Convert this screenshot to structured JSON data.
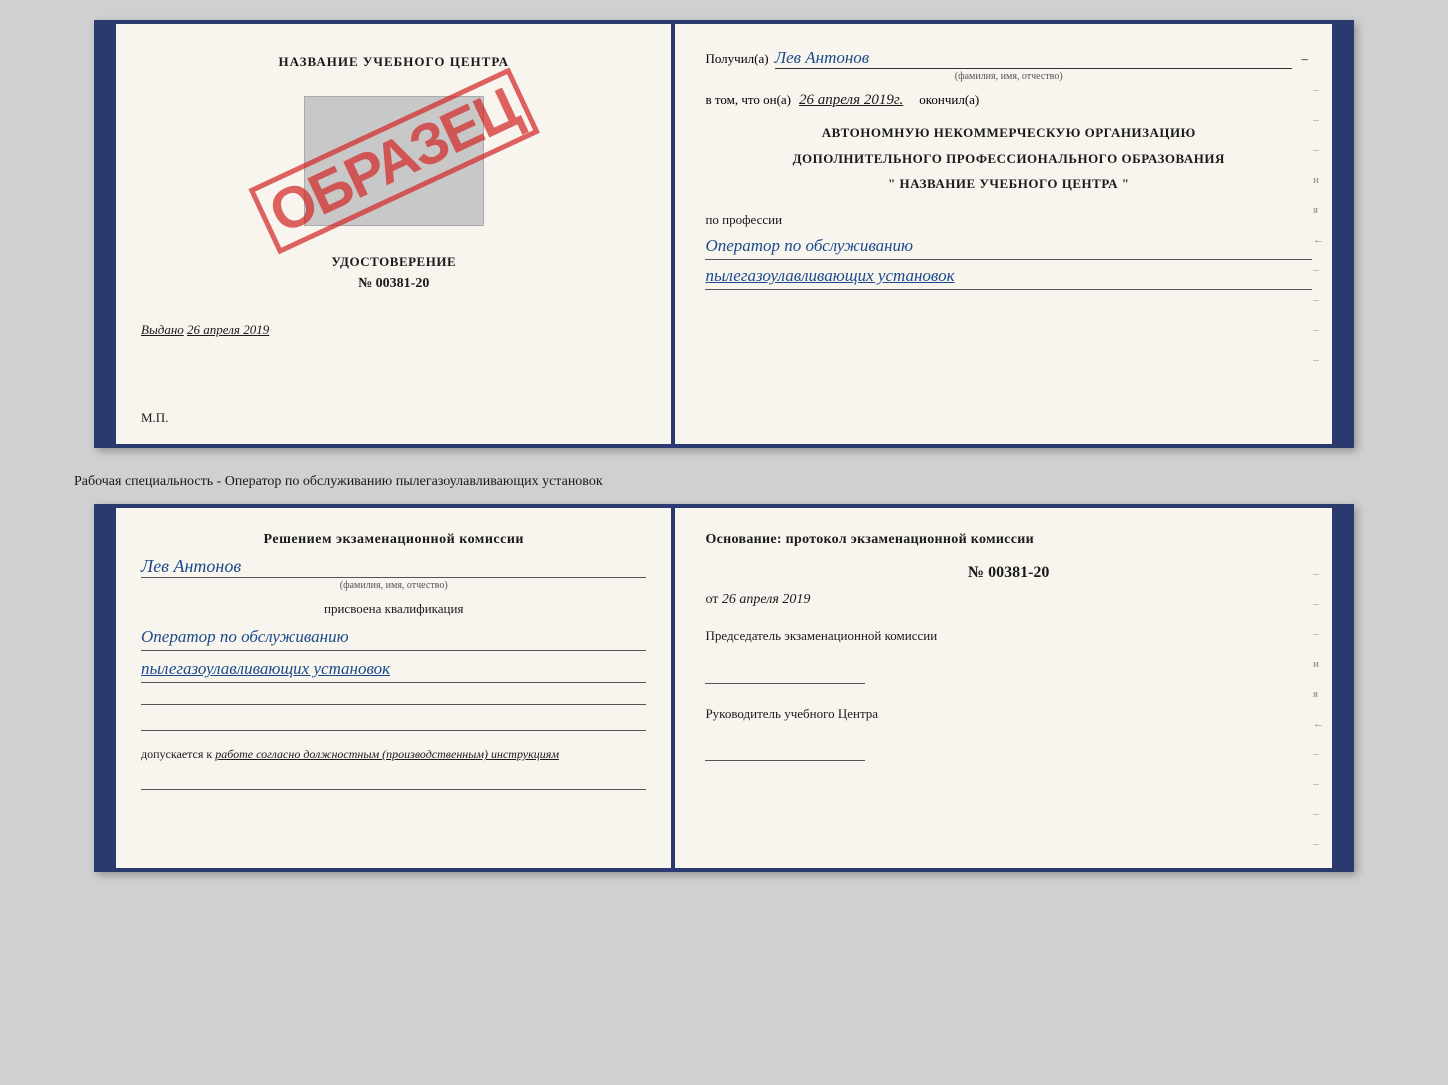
{
  "page": {
    "background_color": "#d0d0d0"
  },
  "book1": {
    "left": {
      "header": "НАЗВАНИЕ УЧЕБНОГО ЦЕНТРА",
      "stamp_text": "ОБРАЗЕЦ",
      "doc_title": "УДОСТОВЕРЕНИЕ",
      "doc_number": "№ 00381-20",
      "issued_label": "Выдано",
      "issued_date": "26 апреля 2019",
      "mp_label": "М.П."
    },
    "right": {
      "poluchil_label": "Получил(а)",
      "poluchil_name": "Лев Антонов",
      "fio_label": "(фамилия, имя, отчество)",
      "vtom_label": "в том, что он(а)",
      "vtom_date": "26 апреля 2019г.",
      "okonchil_label": "окончил(а)",
      "org_line1": "АВТОНОМНУЮ НЕКОММЕРЧЕСКУЮ ОРГАНИЗАЦИЮ",
      "org_line2": "ДОПОЛНИТЕЛЬНОГО ПРОФЕССИОНАЛЬНОГО ОБРАЗОВАНИЯ",
      "org_line3": "\"   НАЗВАНИЕ УЧЕБНОГО ЦЕНТРА   \"",
      "po_professii": "по профессии",
      "profession_line1": "Оператор по обслуживанию",
      "profession_line2": "пылегазоулавливающих установок",
      "side_marks": [
        "–",
        "–",
        "–",
        "и",
        "я",
        "←",
        "–",
        "–",
        "–",
        "–"
      ]
    }
  },
  "separator": {
    "text": "Рабочая специальность - Оператор по обслуживанию пылегазоулавливающих установок"
  },
  "book2": {
    "left": {
      "commission_text": "Решением экзаменационной комиссии",
      "name": "Лев Антонов",
      "fio_label": "(фамилия, имя, отчество)",
      "prisvoena": "присвоена квалификация",
      "profession_line1": "Оператор по обслуживанию",
      "profession_line2": "пылегазоулавливающих установок",
      "dopusk_text": "допускается к",
      "dopusk_italic": "работе согласно должностным (производственным) инструкциям"
    },
    "right": {
      "osnovanie_label": "Основание: протокол экзаменационной комиссии",
      "protocol_number": "№ 00381-20",
      "ot_label": "от",
      "ot_date": "26 апреля 2019",
      "predsedatel_label": "Председатель экзаменационной комиссии",
      "rukovoditel_label": "Руководитель учебного Центра",
      "side_marks": [
        "–",
        "–",
        "–",
        "и",
        "я",
        "←",
        "–",
        "–",
        "–",
        "–"
      ]
    }
  }
}
